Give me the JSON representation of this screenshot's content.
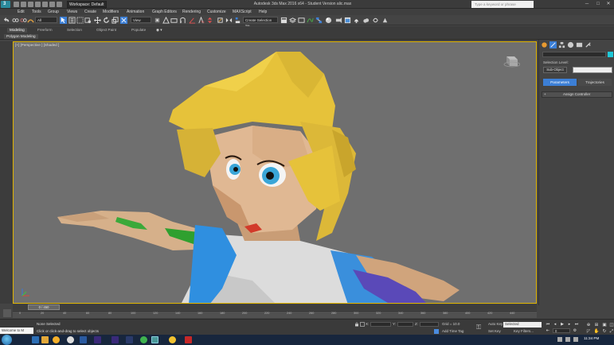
{
  "titlebar": {
    "workspace": "Workspace: Default",
    "window_title": "Autodesk 3ds Max 2016 x64 - Student Version   alic.max",
    "help_search_placeholder": "Type a keyword or phrase",
    "controls": [
      "─",
      "□",
      "✕"
    ]
  },
  "menu": {
    "items": [
      "Edit",
      "Tools",
      "Group",
      "Views",
      "Create",
      "Modifiers",
      "Animation",
      "Graph Editors",
      "Rendering",
      "Customize",
      "MAXScript",
      "Help"
    ]
  },
  "toolbar": {
    "selection_filter": "All",
    "reference_coord": "View",
    "named_selection_set": "Create Selection Se"
  },
  "ribbon": {
    "tabs": [
      "Modeling",
      "Freeform",
      "Selection",
      "Object Paint",
      "Populate"
    ],
    "panel_label": "Polygon Modeling"
  },
  "viewport": {
    "label": "[+] [Perspective ] [Shaded ]",
    "accent_border": "#e0b400"
  },
  "command_panel": {
    "selection_level": "Selection Level:",
    "sub_object": "Sub-Object",
    "parameters": "Parameters",
    "trajectories": "Trajectories",
    "rollout_plus": "+",
    "rollout_title": "Assign Controller",
    "accent": "#3c7fd6",
    "object_color": "#1fc8d8"
  },
  "timeline": {
    "frame_display": "0 / 450",
    "ticks": [
      "0",
      "20",
      "40",
      "60",
      "80",
      "100",
      "120",
      "140",
      "160",
      "180",
      "200",
      "220",
      "240",
      "260",
      "280",
      "300",
      "320",
      "340",
      "360",
      "380",
      "400",
      "420",
      "440"
    ]
  },
  "status": {
    "listener_text": "Welcome to M",
    "selection": "None Selected",
    "prompt": "Click or click-and-drag to select objects",
    "x_label": "X:",
    "y_label": "Y:",
    "z_label": "Z:",
    "grid": "Grid = 10.0",
    "add_time_tag": "Add Time Tag",
    "auto_key": "Auto Key",
    "set_key": "Set Key",
    "selected": "Selected",
    "key_filters": "Key Filters...",
    "frame_value": "0"
  },
  "taskbar": {
    "time": "11:34 PM"
  }
}
